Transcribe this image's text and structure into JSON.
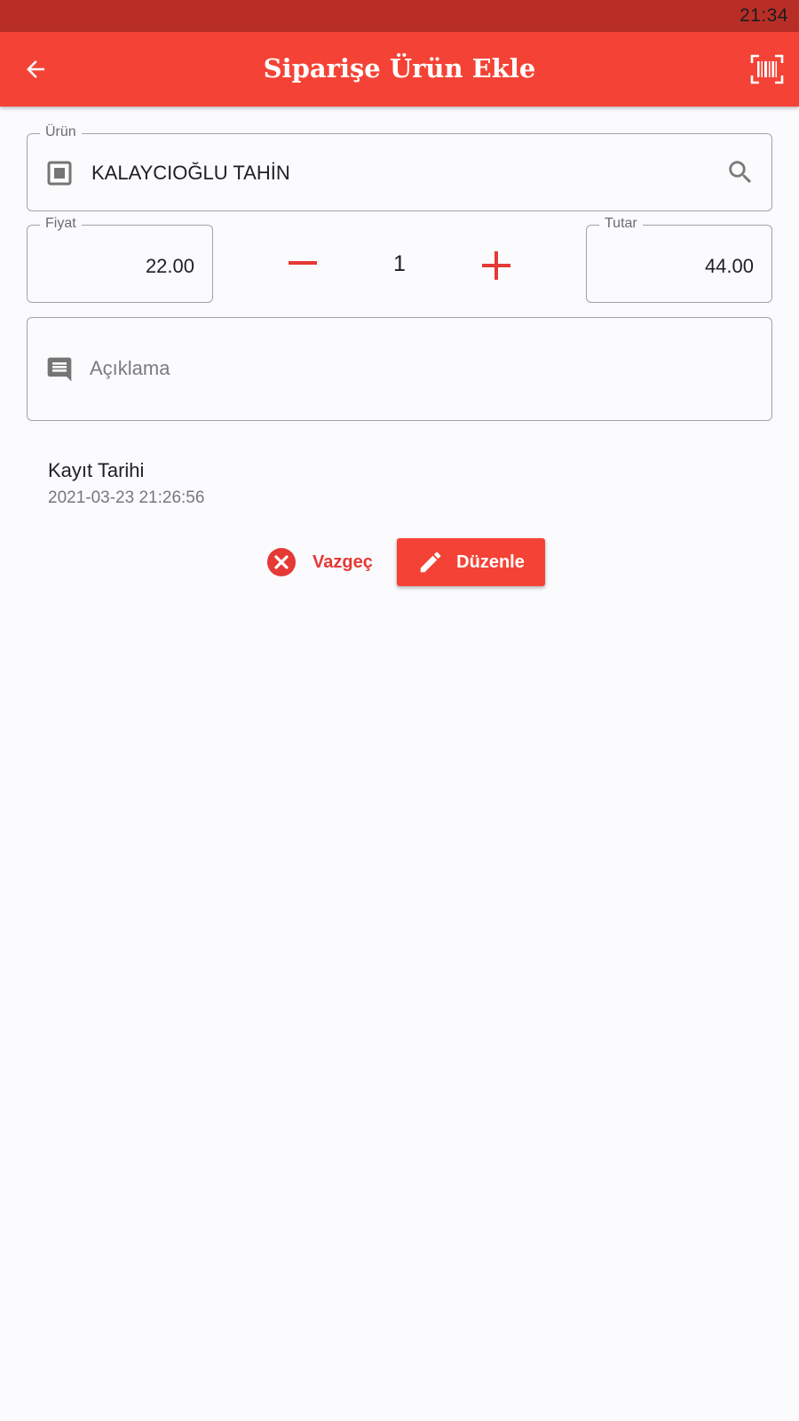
{
  "status_bar": {
    "time": "21:34"
  },
  "app_bar": {
    "title": "Siparişe Ürün Ekle",
    "back_icon": "arrow-back-icon",
    "barcode_icon": "barcode-scan-icon"
  },
  "form": {
    "product": {
      "label": "Ürün",
      "value": "KALAYCIOĞLU TAHİN",
      "icon": "box-icon",
      "search_icon": "search-icon"
    },
    "price": {
      "label": "Fiyat",
      "value": "22.00"
    },
    "quantity": {
      "value": "1",
      "minus_icon": "minus-icon",
      "plus_icon": "plus-icon"
    },
    "total": {
      "label": "Tutar",
      "value": "44.00"
    },
    "note": {
      "placeholder": "Açıklama",
      "value": "",
      "icon": "comment-icon"
    }
  },
  "record": {
    "label": "Kayıt Tarihi",
    "value": "2021-03-23 21:26:56"
  },
  "actions": {
    "cancel_label": "Vazgeç",
    "edit_label": "Düzenle"
  },
  "colors": {
    "primary": "#f44336",
    "status_bar": "#b82e26",
    "accent_text": "#e53935",
    "background": "#fbfafc"
  }
}
